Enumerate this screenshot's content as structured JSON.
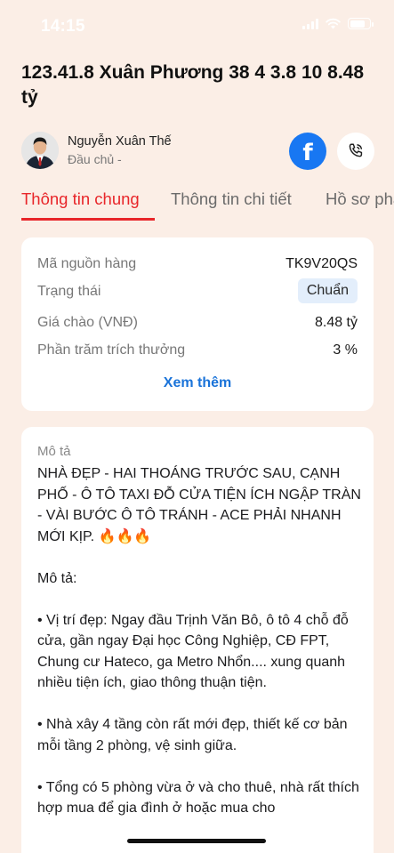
{
  "status_bar": {
    "time": "14:15",
    "battery_level": 0.78
  },
  "listing": {
    "title": "123.41.8 Xuân Phương 38 4 3.8 10 8.48 tỷ"
  },
  "agent": {
    "name": "Nguyễn Xuân Thế",
    "role": "Đầu chủ -",
    "facebook_glyph": "f"
  },
  "tabs": [
    {
      "label": "Thông tin chung",
      "active": true
    },
    {
      "label": "Thông tin chi tiết",
      "active": false
    },
    {
      "label": "Hồ sơ pháp lý",
      "active": false
    }
  ],
  "info": {
    "rows": [
      {
        "label": "Mã nguồn hàng",
        "value": "TK9V20QS"
      },
      {
        "label": "Trạng thái",
        "value": "Chuẩn"
      },
      {
        "label": "Giá chào (VNĐ)",
        "value": "8.48 tỷ"
      },
      {
        "label": "Phần trăm trích thưởng",
        "value": "3 %"
      }
    ],
    "more_label": "Xem thêm"
  },
  "description": {
    "label": "Mô tả",
    "headline": "NHÀ ĐẸP - HAI THOÁNG TRƯỚC SAU, CẠNH PHỐ - Ô TÔ TAXI ĐỖ CỬA TIỆN ÍCH NGẬP TRÀN - VÀI BƯỚC Ô TÔ TRÁNH - ACE PHẢI NHANH MỚI KỊP. 🔥🔥🔥",
    "subheading": "Mô tả:",
    "bullets": [
      "• Vị trí đẹp: Ngay đầu Trịnh Văn Bô,  ô tô 4 chỗ đỗ cửa, gần ngay Đại học Công Nghiệp, CĐ FPT, Chung cư Hateco, ga Metro Nhổn.... xung quanh nhiều tiện ích, giao thông thuận tiện.",
      "• Nhà xây 4 tầng còn rất mới đẹp, thiết kế cơ bản mỗi tầng 2 phòng, vệ sinh giữa.",
      "• Tổng có 5 phòng vừa ở và cho thuê, nhà rất thích hợp mua để gia đình ở hoặc mua cho"
    ]
  },
  "colors": {
    "background": "#fbeee6",
    "accent_red": "#e8262a",
    "link_blue": "#1a73d9",
    "facebook_blue": "#1877f2",
    "badge_bg": "#e3eefb"
  },
  "icons": {
    "facebook": "facebook-icon",
    "call": "phone-call-icon",
    "fire": "fire-emoji"
  }
}
